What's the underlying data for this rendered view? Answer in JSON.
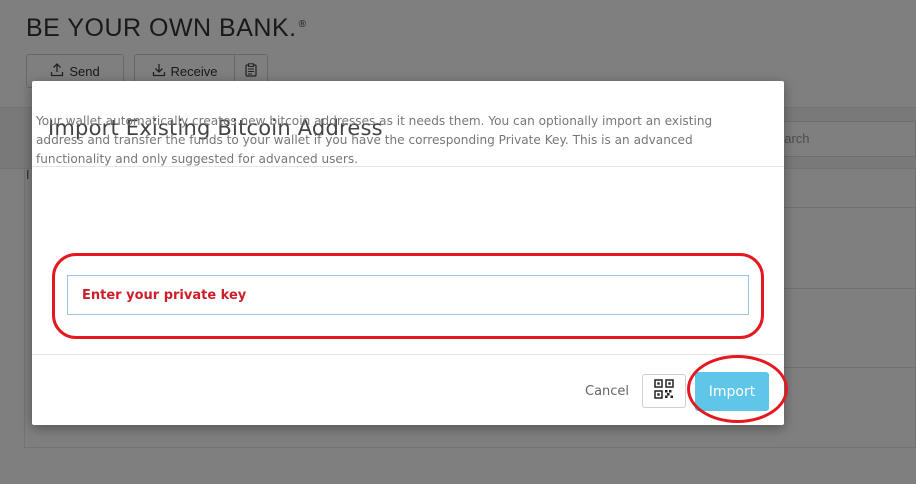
{
  "background": {
    "title": "BE YOUR OWN BANK.",
    "title_mark": "®",
    "send_label": "Send",
    "receive_label": "Receive",
    "search_placeholder": "earch",
    "side_mark": "I"
  },
  "modal": {
    "title": "Import Existing Bitcoin Address",
    "description": "Your wallet automatically creates new bitcoin addresses as it needs them. You can optionally import an existing address and transfer the funds to your wallet if you have the corresponding Private Key. This is an advanced functionality and only suggested for advanced users.",
    "private_key_placeholder": "Enter your private key",
    "cancel_label": "Cancel",
    "import_label": "Import"
  },
  "colors": {
    "highlight_red": "#e3191f",
    "import_blue": "#5fc6ea",
    "placeholder_red": "#cc1f2a"
  },
  "icons": [
    "upload-icon",
    "download-icon",
    "clipboard-icon",
    "qr-code-icon"
  ]
}
